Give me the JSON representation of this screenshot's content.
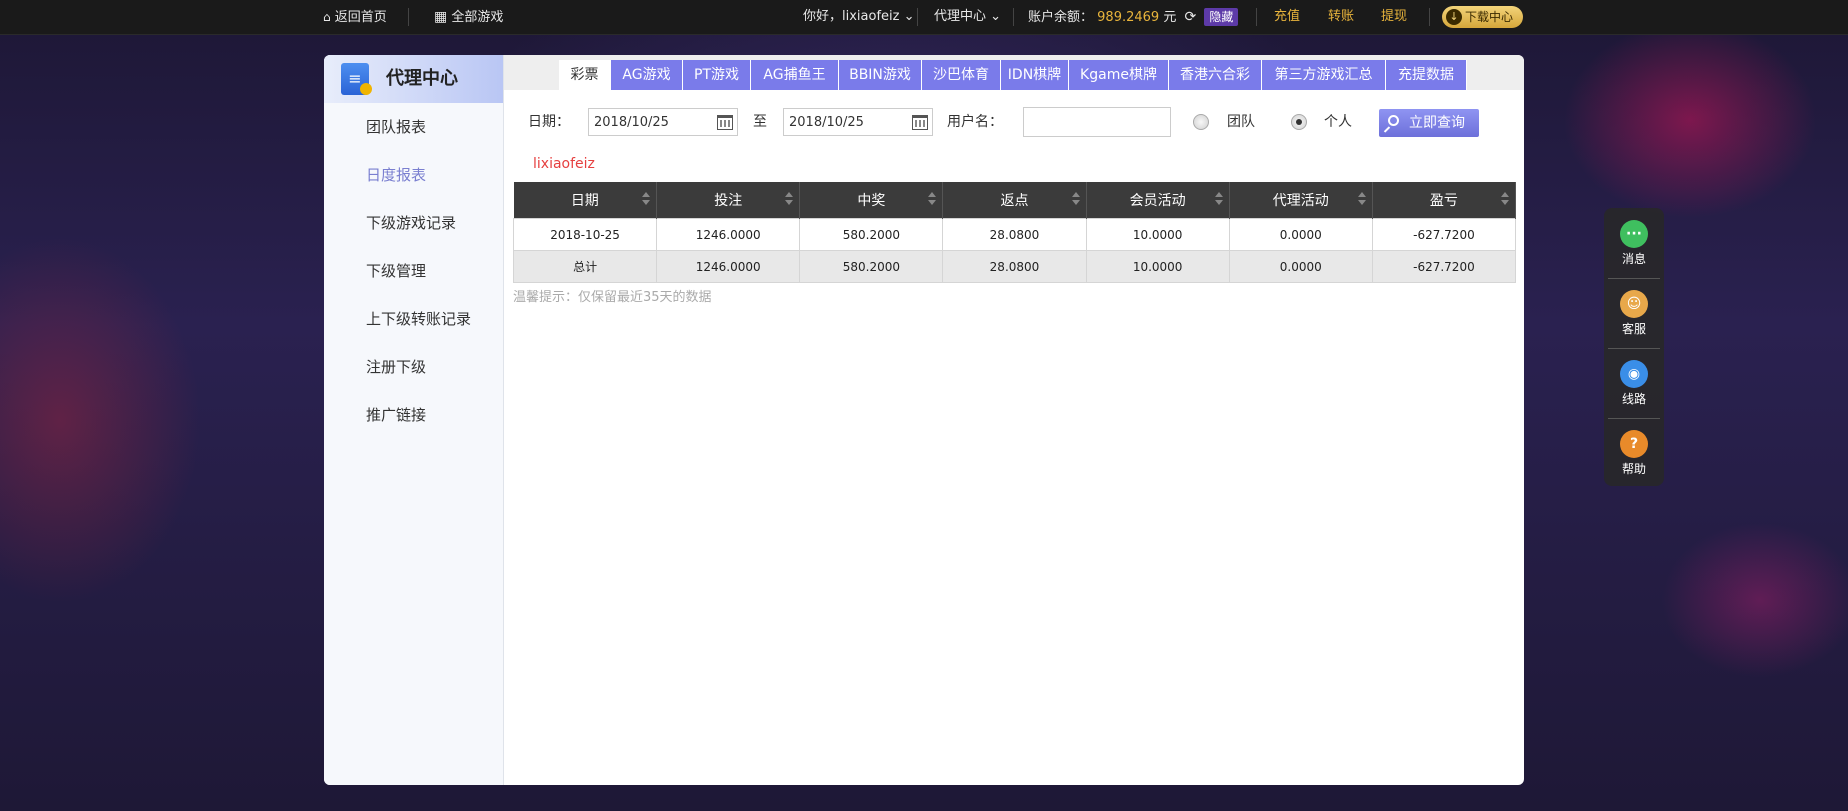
{
  "topbar": {
    "home": "返回首页",
    "all_games": "全部游戏",
    "greeting": "你好，lixiaofeiz",
    "agent_center": "代理中心",
    "balance_label": "账户余额：",
    "balance_value": "989.2469",
    "balance_unit": "元",
    "hide": "隐藏",
    "recharge": "充值",
    "transfer": "转账",
    "withdraw": "提现",
    "download": "下载中心"
  },
  "sidebar": {
    "title": "代理中心",
    "items": [
      {
        "label": "团队报表"
      },
      {
        "label": "日度报表"
      },
      {
        "label": "下级游戏记录"
      },
      {
        "label": "下级管理"
      },
      {
        "label": "上下级转账记录"
      },
      {
        "label": "注册下级"
      },
      {
        "label": "推广链接"
      }
    ],
    "active_index": 1
  },
  "tabs": [
    {
      "label": "彩票"
    },
    {
      "label": "AG游戏"
    },
    {
      "label": "PT游戏"
    },
    {
      "label": "AG捕鱼王"
    },
    {
      "label": "BBIN游戏"
    },
    {
      "label": "沙巴体育"
    },
    {
      "label": "IDN棋牌"
    },
    {
      "label": "Kgame棋牌"
    },
    {
      "label": "香港六合彩"
    },
    {
      "label": "第三方游戏汇总"
    },
    {
      "label": "充提数据"
    }
  ],
  "filters": {
    "date_label": "日期：",
    "date_from": "2018/10/25",
    "to_label": "至",
    "date_to": "2018/10/25",
    "username_label": "用户名：",
    "username_value": "",
    "team_label": "团队",
    "personal_label": "个人",
    "selected": "个人",
    "query_button": "立即查询"
  },
  "current_user": "lixiaofeiz",
  "table": {
    "headers": [
      "日期",
      "投注",
      "中奖",
      "返点",
      "会员活动",
      "代理活动",
      "盈亏"
    ],
    "rows": [
      [
        "2018-10-25",
        "1246.0000",
        "580.2000",
        "28.0800",
        "10.0000",
        "0.0000",
        "-627.7200"
      ]
    ],
    "total": [
      "总计",
      "1246.0000",
      "580.2000",
      "28.0800",
      "10.0000",
      "0.0000",
      "-627.7200"
    ]
  },
  "tip": "温馨提示：仅保留最近35天的数据",
  "float_menu": [
    {
      "label": "消息",
      "icon": "message-icon",
      "color": "#3fbf5f",
      "glyph": "···"
    },
    {
      "label": "客服",
      "icon": "support-icon",
      "color": "#e8a84a",
      "glyph": "☺"
    },
    {
      "label": "线路",
      "icon": "route-icon",
      "color": "#3a8ee8",
      "glyph": "◉"
    },
    {
      "label": "帮助",
      "icon": "help-icon",
      "color": "#e88a2a",
      "glyph": "?"
    }
  ]
}
